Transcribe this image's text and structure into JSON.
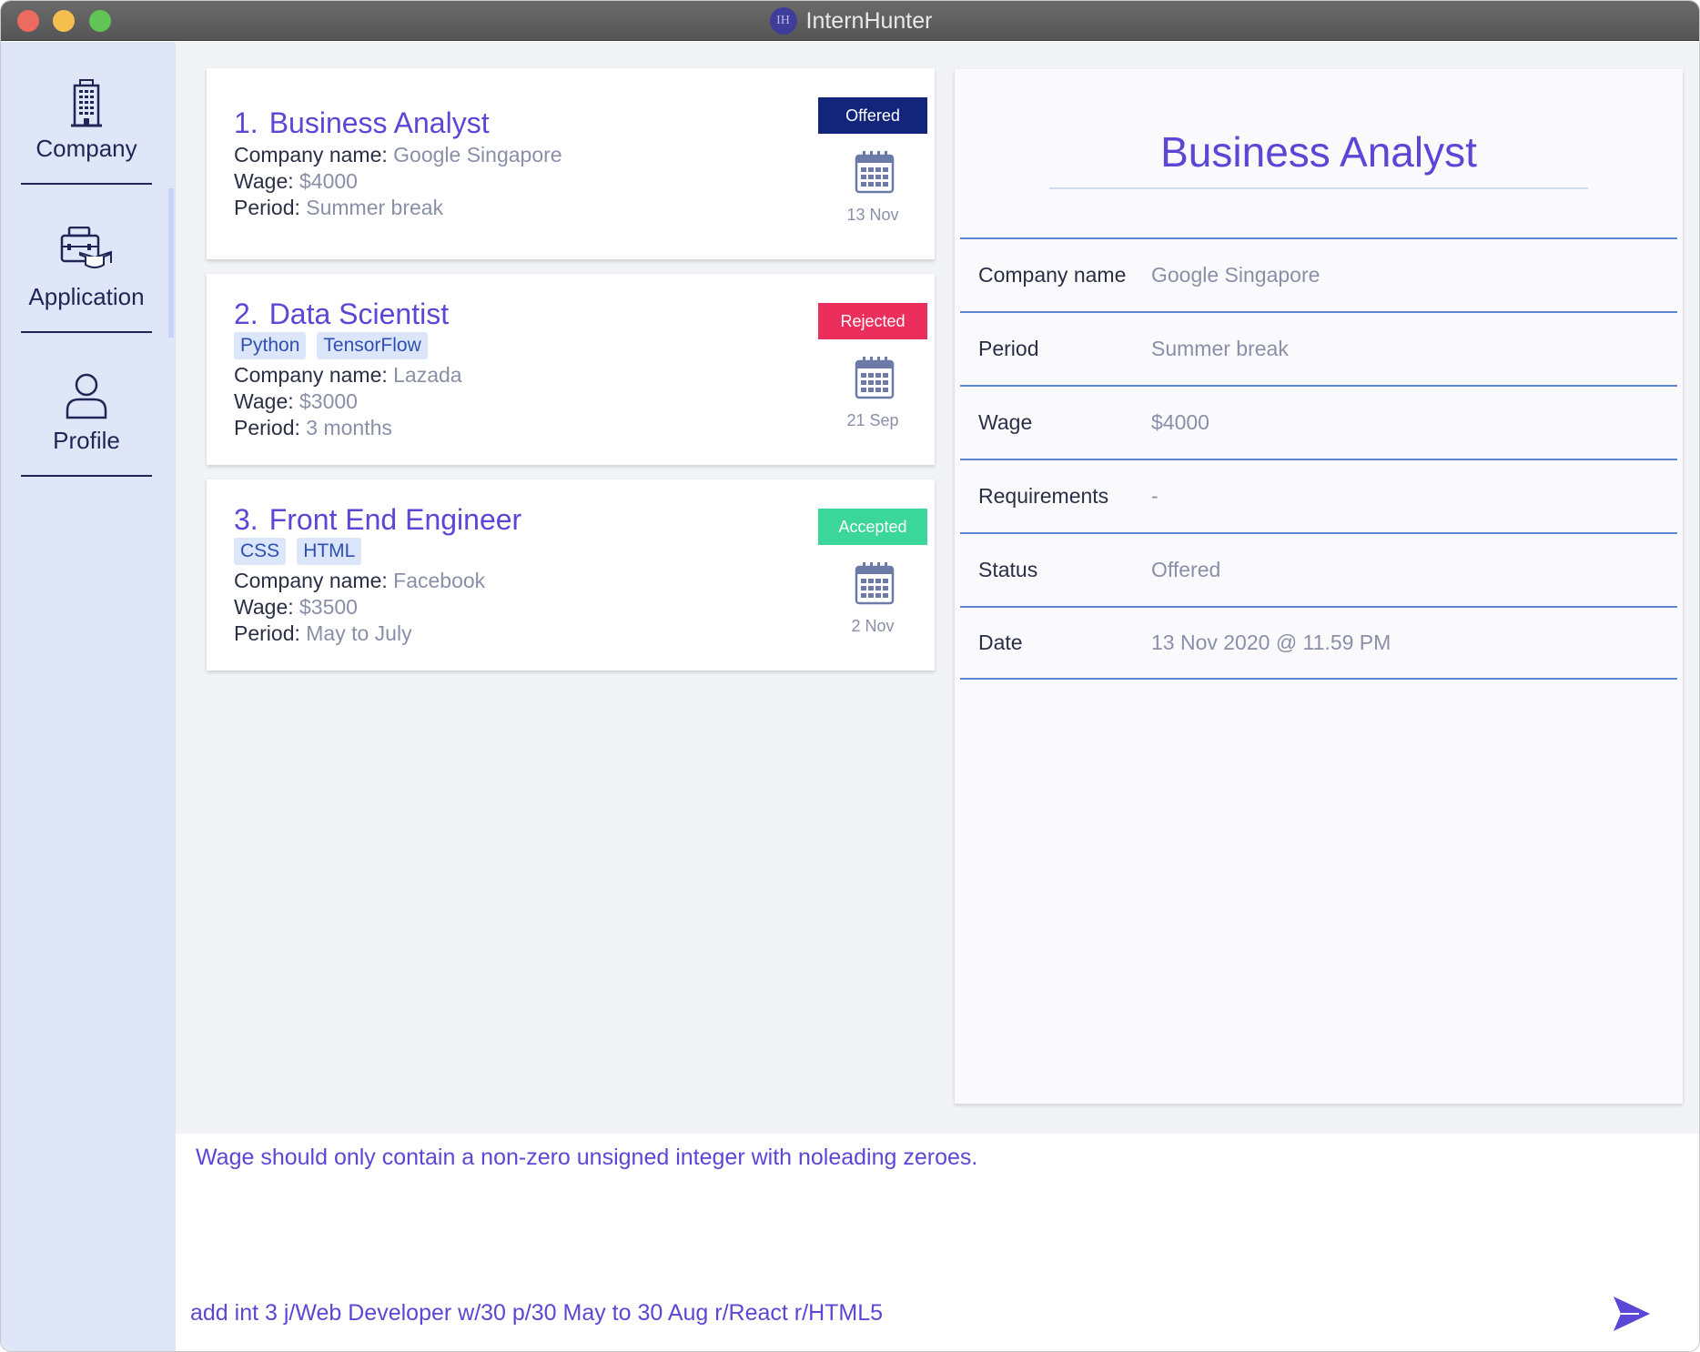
{
  "window": {
    "title": "InternHunter",
    "logo_text": "IH"
  },
  "sidebar": {
    "items": [
      {
        "label": "Company",
        "icon": "building-icon"
      },
      {
        "label": "Application",
        "icon": "briefcase-graduation-icon"
      },
      {
        "label": "Profile",
        "icon": "user-icon"
      }
    ]
  },
  "applications": [
    {
      "index": "1.",
      "title": "Business Analyst",
      "tags": [],
      "company_label": "Company name:",
      "company": "Google Singapore",
      "wage_label": "Wage:",
      "wage": "$4000",
      "period_label": "Period:",
      "period": "Summer break",
      "status": "Offered",
      "status_color": "#13257a",
      "date": "13 Nov"
    },
    {
      "index": "2.",
      "title": "Data Scientist",
      "tags": [
        "Python",
        "TensorFlow"
      ],
      "company_label": "Company name:",
      "company": "Lazada",
      "wage_label": "Wage:",
      "wage": "$3000",
      "period_label": "Period:",
      "period": "3 months",
      "status": "Rejected",
      "status_color": "#ec2e5c",
      "date": "21 Sep"
    },
    {
      "index": "3.",
      "title": "Front End Engineer",
      "tags": [
        "CSS",
        "HTML"
      ],
      "company_label": "Company name:",
      "company": "Facebook",
      "wage_label": "Wage:",
      "wage": "$3500",
      "period_label": "Period:",
      "period": "May to July",
      "status": "Accepted",
      "status_color": "#3ad69a",
      "date": "2 Nov"
    }
  ],
  "detail": {
    "title": "Business Analyst",
    "rows": [
      {
        "label": "Company name",
        "value": "Google Singapore"
      },
      {
        "label": "Period",
        "value": "Summer break"
      },
      {
        "label": "Wage",
        "value": "$4000"
      },
      {
        "label": "Requirements",
        "value": "-"
      },
      {
        "label": "Status",
        "value": "Offered"
      },
      {
        "label": "Date",
        "value": "13 Nov 2020 @ 11.59 PM"
      }
    ]
  },
  "result": {
    "message": "Wage should only contain a non-zero unsigned integer with noleading zeroes."
  },
  "command": {
    "value": "add int 3 j/Web Developer w/30 p/30 May to 30 Aug r/React r/HTML5"
  },
  "colors": {
    "accent": "#5b47d6",
    "sidebar_bg": "#dfe6f8",
    "divider": "#5e85cf"
  }
}
